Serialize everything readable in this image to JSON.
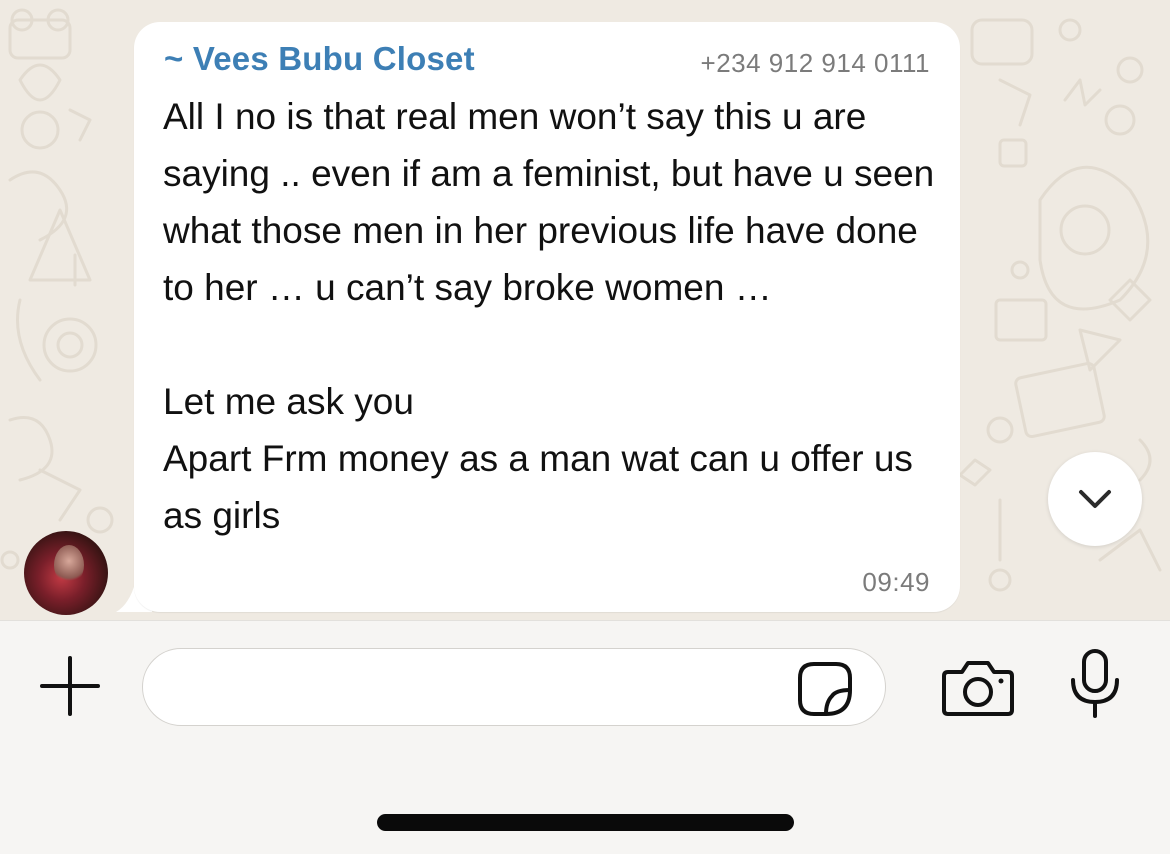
{
  "message": {
    "sender_name": "~ Vees Bubu Closet",
    "sender_phone": "+234 912 914 0111",
    "text": "All I no is that real men won’t say this u are saying .. even if am a feminist, but have u seen what those men in her previous life have done to her … u can’t say broke women …\n\nLet me ask you\nApart Frm money as a man wat can u offer us as girls",
    "time": "09:49"
  },
  "input_bar": {
    "message_value": "",
    "message_placeholder": ""
  },
  "icons": {
    "attach": "plus-icon",
    "sticker": "sticker-icon",
    "camera": "camera-icon",
    "mic": "microphone-icon",
    "scroll_down": "chevron-down-icon"
  },
  "colors": {
    "sender_name": "#3d7fb5",
    "wallpaper": "#efeae2",
    "bubble": "#ffffff",
    "meta_text": "#7b7b7b"
  }
}
